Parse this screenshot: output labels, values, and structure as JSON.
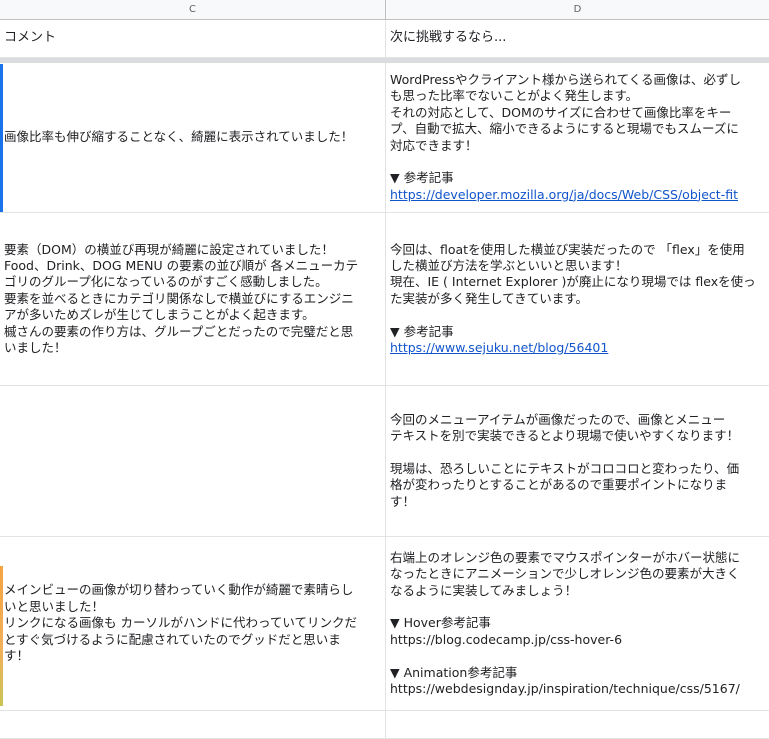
{
  "sheet": {
    "columns": [
      "C",
      "D"
    ],
    "headers": {
      "c": "コメント",
      "d": "次に挑戦するなら..."
    },
    "rows": [
      {
        "c": [
          "画像比率も伸び縮することなく、綺麗に表示されていました！"
        ],
        "d": [
          "WordPressやクライアント様から送られてくる画像は、必ずし",
          "も思った比率でないことがよく発生します。",
          "それの対応として、DOMのサイズに合わせて画像比率をキー",
          "プ、自動で拡大、縮小できるようにすると現場でもスムーズに",
          "対応できます！",
          "",
          "▼ 参考記事"
        ],
        "d_link": "https://developer.mozilla.org/ja/docs/Web/CSS/object-fit"
      },
      {
        "c": [
          "要素（DOM）の横並び再現が綺麗に設定されていました！",
          "Food、Drink、DOG MENU の要素の並び順が 各メニューカテ",
          "ゴリのグループ化になっているのがすごく感動しました。",
          "要素を並べるときにカテゴリ関係なしで横並びにするエンジニ",
          "アが多いためズレが生じてしまうことがよく起きます。",
          "槭さんの要素の作り方は、グループごとだったので完璧だと思",
          "いました！"
        ],
        "d": [
          "今回は、floatを使用した横並び実装だったので 「flex」を使用",
          "した横並び方法を学ぶといいと思います！",
          "現在、IE ( Internet Explorer )が廃止になり現場では flexを使っ",
          "た実装が多く発生してきています。",
          "",
          "▼ 参考記事"
        ],
        "d_link": "https://www.sejuku.net/blog/56401"
      },
      {
        "c": [],
        "d": [
          "今回のメニューアイテムが画像だったので、画像とメニュー",
          "テキストを別で実装できるとより現場で使いやすくなります！",
          "",
          "現場は、恐ろしいことにテキストがコロコロと変わったり、価",
          "格が変わったりとすることがあるので重要ポイントになりま",
          "す！"
        ],
        "d_link": ""
      },
      {
        "c": [
          "メインビューの画像が切り替わっていく動作が綺麗で素晴らし",
          "いと思いました！",
          "リンクになる画像も カーソルがハンドに代わっていてリンクだ",
          "とすぐ気づけるように配慮されていたのでグッドだと思いま",
          "す！"
        ],
        "d": [
          "右端上のオレンジ色の要素でマウスポインターがホバー状態に",
          "なったときにアニメーションで少しオレンジ色の要素が大きく",
          "なるように実装してみましょう！",
          "",
          "▼ Hover参考記事",
          "https://blog.codecamp.jp/css-hover-6",
          "",
          "▼ Animation参考記事",
          "https://webdesignday.jp/inspiration/technique/css/5167/"
        ],
        "d_link": ""
      }
    ]
  },
  "colors": {
    "row1_stripe": "#1a73e8",
    "row4_stripe": "#f4a340",
    "link": "#1155cc"
  }
}
